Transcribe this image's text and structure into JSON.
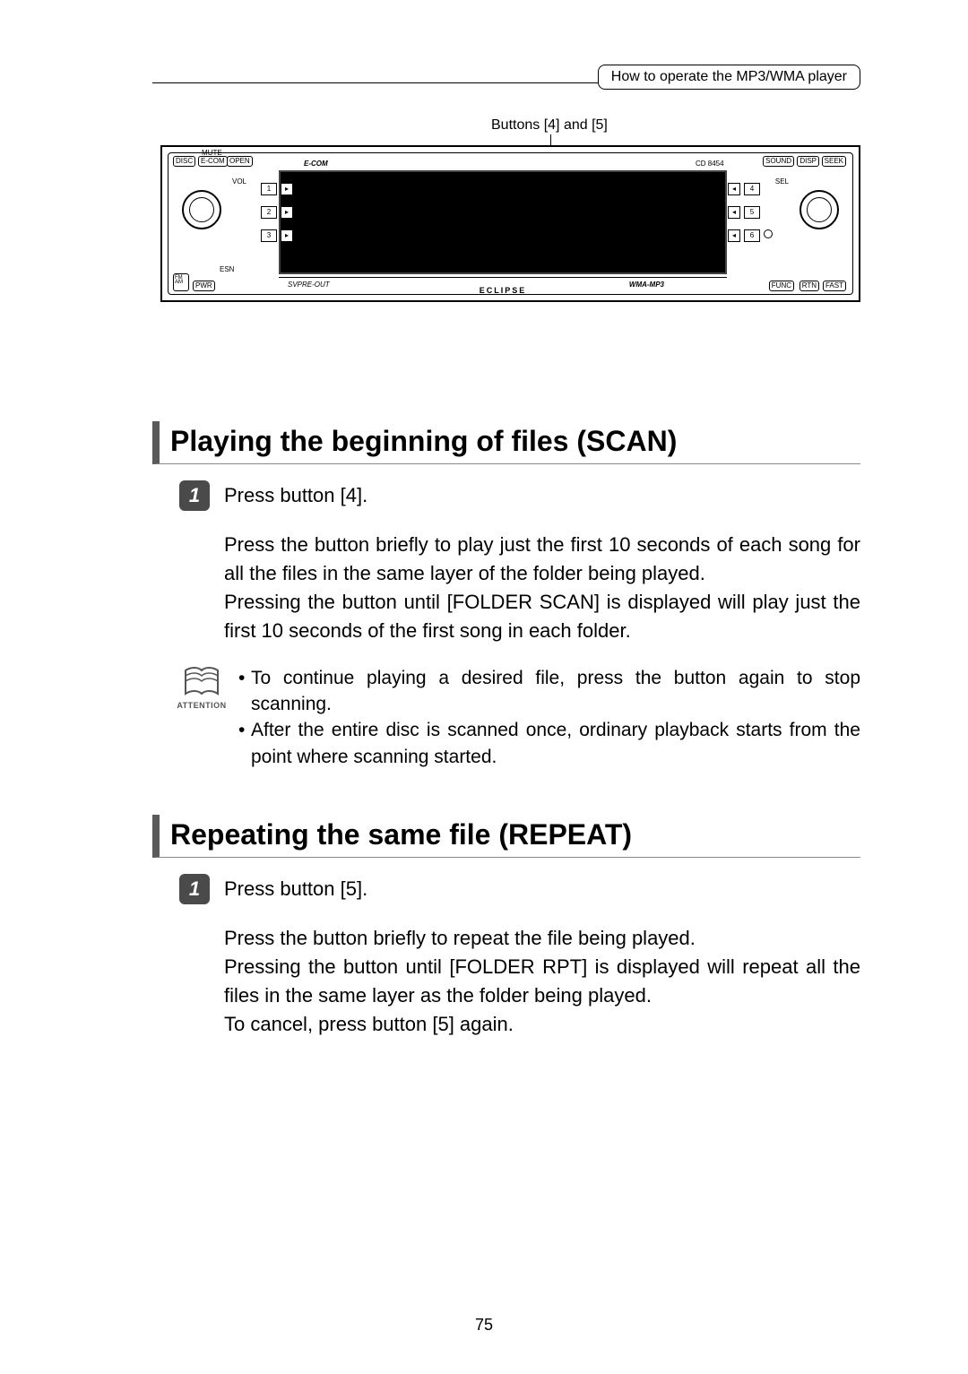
{
  "header": {
    "section_title": "How to operate the MP3/WMA player"
  },
  "diagram": {
    "callout_label": "Buttons [4] and [5]",
    "model": "CD 8454",
    "left_brand": "E-COM",
    "brand_bottom": "ECLIPSE",
    "top_labels": {
      "mute": "MUTE",
      "disc": "DISC",
      "ecom": "E-COM",
      "open": "OPEN",
      "sound": "SOUND",
      "disp": "DISP",
      "seek": "SEEK"
    },
    "side_labels": {
      "vol": "VOL",
      "sel": "SEL"
    },
    "left_rows": [
      "1",
      "2",
      "3"
    ],
    "right_rows": [
      "4",
      "5",
      "6"
    ],
    "bottom_labels": {
      "esn": "ESN",
      "fm": "FM",
      "am": "AM",
      "pwr": "PWR",
      "sv": "SVPRE-OUT",
      "wma": "WMA-MP3",
      "func": "FUNC",
      "rtn": "RTN",
      "fast": "FAST"
    }
  },
  "section1": {
    "title": "Playing the beginning of files (SCAN)",
    "step_num": "1",
    "step_head": "Press button [4].",
    "body": "Press the button briefly to play just the first 10 seconds of each song for all the files in the same layer of the folder being played.\nPressing the button until [FOLDER SCAN] is displayed will play just the first 10 seconds of the first song in each folder.",
    "attention_label": "ATTENTION",
    "attention_bullets": [
      "To continue playing a desired file, press the button again to stop scanning.",
      "After the entire disc is scanned once, ordinary playback starts from the point where scanning started."
    ]
  },
  "section2": {
    "title": "Repeating the same file (REPEAT)",
    "step_num": "1",
    "step_head": "Press button [5].",
    "body": "Press the button briefly to repeat the file being played.\nPressing the button until [FOLDER RPT] is displayed will repeat all the files in the same layer as the folder being played.\nTo cancel, press button [5] again."
  },
  "page_number": "75"
}
